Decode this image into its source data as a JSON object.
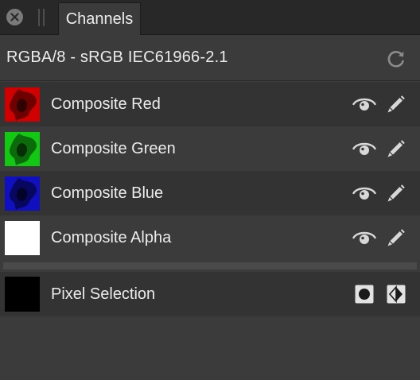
{
  "tab": {
    "label": "Channels"
  },
  "header": {
    "profile": "RGBA/8 - sRGB IEC61966-2.1"
  },
  "channels": [
    {
      "label": "Composite Red",
      "color": "#d10000"
    },
    {
      "label": "Composite Green",
      "color": "#12c812"
    },
    {
      "label": "Composite Blue",
      "color": "#1010c0"
    },
    {
      "label": "Composite Alpha",
      "color": "#ffffff"
    }
  ],
  "pixel_selection": {
    "label": "Pixel Selection",
    "color": "#000000"
  },
  "colors": {
    "panel_bg": "#3b3b3b",
    "row_dark": "#333333",
    "tabbar_bg": "#282828",
    "icon": "#d8d8d8"
  }
}
